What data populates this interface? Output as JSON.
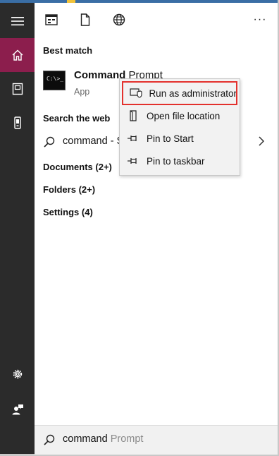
{
  "colors": {
    "sidebar": "#2b2b2b",
    "active_accent": "#8c1e4d",
    "highlight_outline": "#e3312d",
    "menu_bg": "#f2f2f2"
  },
  "sidebar": {
    "items": [
      {
        "icon": "hamburger-menu-icon"
      },
      {
        "icon": "home-icon",
        "active": true
      },
      {
        "icon": "documents-icon"
      },
      {
        "icon": "device-icon"
      },
      {
        "icon": "settings-gear-icon"
      },
      {
        "icon": "user-feedback-icon"
      }
    ]
  },
  "topbar": {
    "icons": [
      "apps-window-icon",
      "document-icon",
      "globe-icon"
    ],
    "more_label": "···"
  },
  "best_match": {
    "title": "Best match",
    "result": {
      "name_bold": "Command",
      "name_rest": " Prompt",
      "type": "App",
      "icon": "cmd-console-icon",
      "icon_glyph": "C:\\>_"
    }
  },
  "search_the_web": {
    "title": "Search the web",
    "query_label": "command - S"
  },
  "categories": [
    {
      "label": "Documents (2+)"
    },
    {
      "label": "Folders (2+)"
    },
    {
      "label": "Settings (4)"
    }
  ],
  "context_menu": {
    "items": [
      {
        "label": "Run as administrator",
        "icon": "admin-shield-icon",
        "highlighted": true
      },
      {
        "label": "Open file location",
        "icon": "file-location-icon"
      },
      {
        "label": "Pin to Start",
        "icon": "pin-icon"
      },
      {
        "label": "Pin to taskbar",
        "icon": "pin-icon"
      }
    ]
  },
  "search_box": {
    "typed": "command",
    "suggestion": " Prompt"
  }
}
